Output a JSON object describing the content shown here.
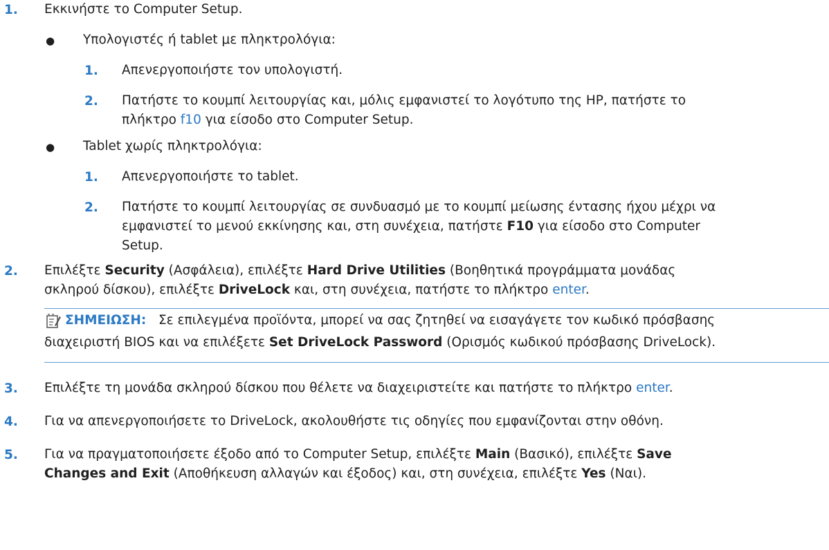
{
  "steps": {
    "s1": {
      "num": "1.",
      "text": "Εκκινήστε το Computer Setup."
    },
    "b1": {
      "text": "Υπολογιστές ή tablet με πληκτρολόγια:"
    },
    "b1_1": {
      "num": "1.",
      "text": "Απενεργοποιήστε τον υπολογιστή."
    },
    "b1_2": {
      "num": "2.",
      "line1": "Πατήστε το κουμπί λειτουργίας και, μόλις εμφανιστεί το λογότυπο της HP, πατήστε το",
      "line2_a": "πλήκτρο ",
      "line2_key": "f10",
      "line2_b": " για είσοδο στο Computer Setup."
    },
    "b2": {
      "text": "Tablet χωρίς πληκτρολόγια:"
    },
    "b2_1": {
      "num": "1.",
      "text": "Απενεργοποιήστε το tablet."
    },
    "b2_2": {
      "num": "2.",
      "line1": "Πατήστε το κουμπί λειτουργίας σε συνδυασμό με το κουμπί μείωσης έντασης ήχου μέχρι να",
      "line2_a": "εμφανιστεί το μενού εκκίνησης και, στη συνέχεια, πατήστε ",
      "line2_key": "F10",
      "line2_b": " για είσοδο στο Computer",
      "line3": "Setup."
    },
    "s2": {
      "num": "2.",
      "a": "Επιλέξτε ",
      "b_security": "Security",
      "c": " (Ασφάλεια), επιλέξτε ",
      "b_hdu": "Hard Drive Utilities",
      "d": " (Βοηθητικά προγράμματα μονάδας",
      "e": "σκληρού δίσκου), επιλέξτε ",
      "b_drivelock": "DriveLock",
      "f": " και, στη συνέχεια, πατήστε το πλήκτρο ",
      "key": "enter",
      "g": "."
    },
    "note": {
      "label": "ΣΗΜΕΙΩΣΗ:",
      "line1": "Σε επιλεγμένα προϊόντα, μπορεί να σας ζητηθεί να εισαγάγετε τον κωδικό πρόσβασης",
      "line2_a": "διαχειριστή BIOS και να επιλέξετε ",
      "line2_bold": "Set DriveLock Password",
      "line2_b": " (Ορισμός κωδικού πρόσβασης DriveLock)."
    },
    "s3": {
      "num": "3.",
      "a": "Επιλέξτε τη μονάδα σκληρού δίσκου που θέλετε να διαχειριστείτε και πατήστε το πλήκτρο ",
      "key": "enter",
      "b": "."
    },
    "s4": {
      "num": "4.",
      "text": "Για να απενεργοποιήσετε το DriveLock, ακολουθήστε τις οδηγίες που εμφανίζονται στην οθόνη."
    },
    "s5": {
      "num": "5.",
      "a": "Για να πραγματοποιήσετε έξοδο από το Computer Setup, επιλέξτε ",
      "b_main": "Main",
      "c": " (Βασικό), επιλέξτε ",
      "b_save": "Save",
      "b_changes": "Changes and Exit",
      "d": " (Αποθήκευση αλλαγών και έξοδος) και, στη συνέχεια, επιλέξτε ",
      "b_yes": "Yes",
      "e": " (Ναι)."
    }
  },
  "icons": {
    "note": "note-pencil-icon"
  },
  "colors": {
    "accent": "#2a79c4",
    "rule": "#5b9bd5"
  }
}
